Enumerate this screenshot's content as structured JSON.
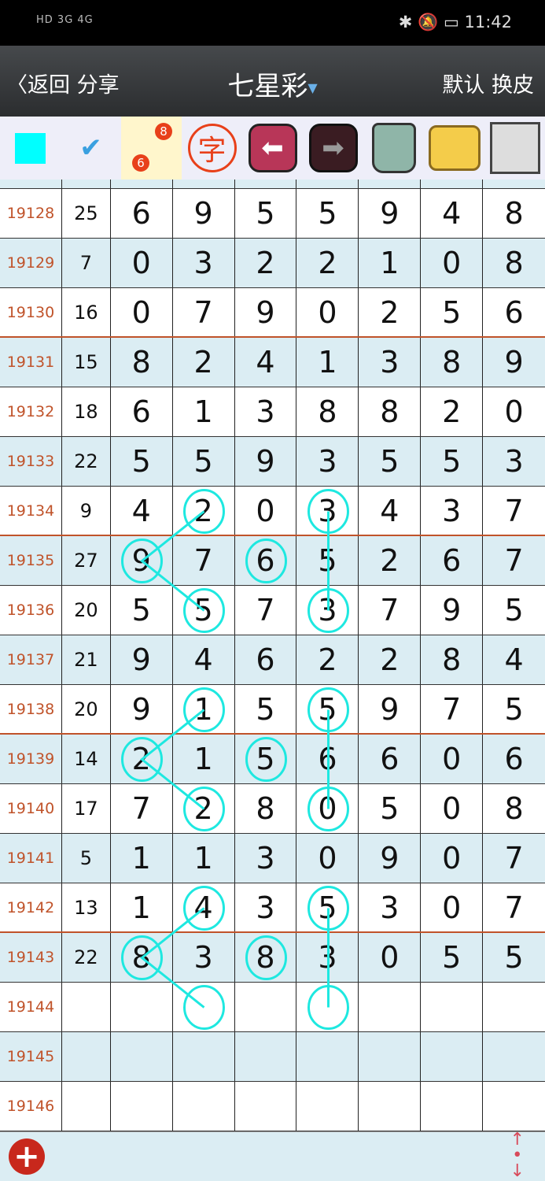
{
  "status": {
    "left": "HD 3G 4G",
    "time": "11:42"
  },
  "header": {
    "back": "返回",
    "share": "分享",
    "title": "七星彩",
    "default": "默认",
    "skin": "换皮"
  },
  "toolbar": [
    "color-square",
    "check-mark",
    "link-6-8",
    "zi-character",
    "arrow-left",
    "arrow-right",
    "trash",
    "photo-folder",
    "floppy-save"
  ],
  "toolbar_glyphs": {
    "link_small": "6",
    "link_big": "8",
    "zi": "字"
  },
  "colors": {
    "accent": "#1ee8e0",
    "issue": "#c0532a",
    "rowAlt": "#dbedf3",
    "separator": "#c0532a"
  },
  "rows": [
    {
      "issue": "19128",
      "sum": "25",
      "d": [
        "6",
        "9",
        "5",
        "5",
        "9",
        "4",
        "8"
      ]
    },
    {
      "issue": "19129",
      "sum": "7",
      "d": [
        "0",
        "3",
        "2",
        "2",
        "1",
        "0",
        "8"
      ]
    },
    {
      "issue": "19130",
      "sum": "16",
      "d": [
        "0",
        "7",
        "9",
        "0",
        "2",
        "5",
        "6"
      ]
    },
    {
      "issue": "19131",
      "sum": "15",
      "d": [
        "8",
        "2",
        "4",
        "1",
        "3",
        "8",
        "9"
      ]
    },
    {
      "issue": "19132",
      "sum": "18",
      "d": [
        "6",
        "1",
        "3",
        "8",
        "8",
        "2",
        "0"
      ]
    },
    {
      "issue": "19133",
      "sum": "22",
      "d": [
        "5",
        "5",
        "9",
        "3",
        "5",
        "5",
        "3"
      ]
    },
    {
      "issue": "19134",
      "sum": "9",
      "d": [
        "4",
        "2",
        "0",
        "3",
        "4",
        "3",
        "7"
      ]
    },
    {
      "issue": "19135",
      "sum": "27",
      "d": [
        "9",
        "7",
        "6",
        "5",
        "2",
        "6",
        "7"
      ]
    },
    {
      "issue": "19136",
      "sum": "20",
      "d": [
        "5",
        "5",
        "7",
        "3",
        "7",
        "9",
        "5"
      ]
    },
    {
      "issue": "19137",
      "sum": "21",
      "d": [
        "9",
        "4",
        "6",
        "2",
        "2",
        "8",
        "4"
      ]
    },
    {
      "issue": "19138",
      "sum": "20",
      "d": [
        "9",
        "1",
        "5",
        "5",
        "9",
        "7",
        "5"
      ]
    },
    {
      "issue": "19139",
      "sum": "14",
      "d": [
        "2",
        "1",
        "5",
        "6",
        "6",
        "0",
        "6"
      ]
    },
    {
      "issue": "19140",
      "sum": "17",
      "d": [
        "7",
        "2",
        "8",
        "0",
        "5",
        "0",
        "8"
      ]
    },
    {
      "issue": "19141",
      "sum": "5",
      "d": [
        "1",
        "1",
        "3",
        "0",
        "9",
        "0",
        "7"
      ]
    },
    {
      "issue": "19142",
      "sum": "13",
      "d": [
        "1",
        "4",
        "3",
        "5",
        "3",
        "0",
        "7"
      ]
    },
    {
      "issue": "19143",
      "sum": "22",
      "d": [
        "8",
        "3",
        "8",
        "3",
        "0",
        "5",
        "5"
      ]
    },
    {
      "issue": "19144",
      "sum": "",
      "d": [
        "",
        "",
        "",
        "",
        "",
        "",
        ""
      ]
    },
    {
      "issue": "19145",
      "sum": "",
      "d": [
        "",
        "",
        "",
        "",
        "",
        "",
        ""
      ]
    },
    {
      "issue": "19146",
      "sum": "",
      "d": [
        "",
        "",
        "",
        "",
        "",
        "",
        ""
      ]
    }
  ],
  "marks": {
    "circles": [
      [
        6,
        1
      ],
      [
        6,
        3
      ],
      [
        7,
        0
      ],
      [
        7,
        2
      ],
      [
        8,
        1
      ],
      [
        8,
        3
      ],
      [
        10,
        1
      ],
      [
        10,
        3
      ],
      [
        11,
        0
      ],
      [
        11,
        2
      ],
      [
        12,
        1
      ],
      [
        12,
        3
      ],
      [
        14,
        1
      ],
      [
        14,
        3
      ],
      [
        15,
        0
      ],
      [
        15,
        2
      ],
      [
        16,
        1
      ],
      [
        16,
        3
      ]
    ],
    "lines": [
      [
        [
          6,
          1
        ],
        [
          7,
          0
        ],
        [
          8,
          1
        ]
      ],
      [
        [
          6,
          3
        ],
        [
          8,
          3
        ]
      ],
      [
        [
          10,
          1
        ],
        [
          11,
          0
        ],
        [
          12,
          1
        ]
      ],
      [
        [
          10,
          3
        ],
        [
          12,
          3
        ]
      ],
      [
        [
          14,
          1
        ],
        [
          15,
          0
        ],
        [
          16,
          1
        ]
      ],
      [
        [
          14,
          3
        ],
        [
          16,
          3
        ]
      ]
    ]
  },
  "footer": {
    "add": "add-icon",
    "scroll": "up-down-arrows-icon"
  }
}
